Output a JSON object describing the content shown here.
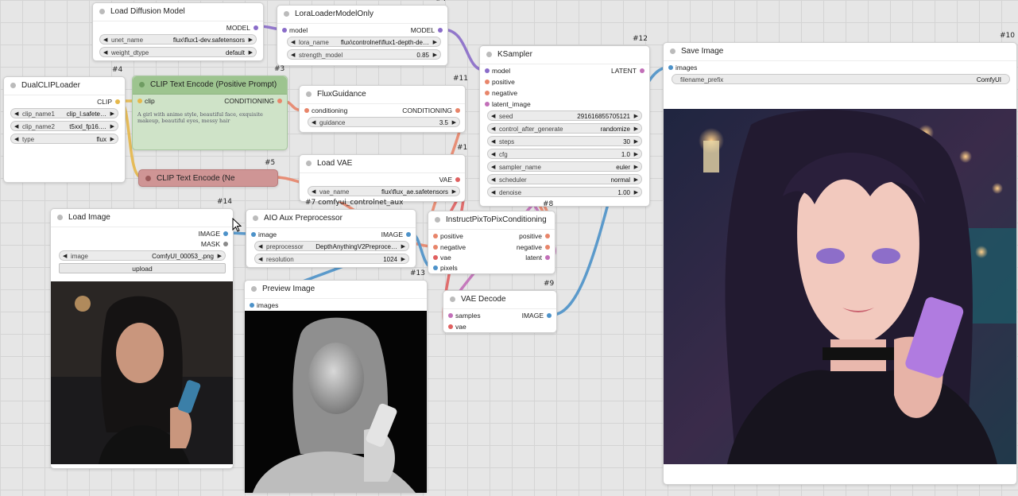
{
  "colors": {
    "model": "#8a6cc9",
    "clip": "#e6b84a",
    "conditioning": "#e8856a",
    "vae": "#e06060",
    "latent": "#c26fb8",
    "image": "#4d92c9",
    "mask": "#8a8a8a",
    "float": "#aaaaaa"
  },
  "nodes": {
    "load_diffusion_model": {
      "title": "Load Diffusion Model",
      "out_model": "MODEL",
      "unet_name_label": "unet_name",
      "unet_name_value": "flux\\flux1-dev.safetensors",
      "weight_dtype_label": "weight_dtype",
      "weight_dtype_value": "default"
    },
    "lora_loader": {
      "id": "#4",
      "title": "LoraLoaderModelOnly",
      "in_model": "model",
      "out_model": "MODEL",
      "lora_name_label": "lora_name",
      "lora_name_value": "flux\\controlnet\\flux1-depth-de…",
      "strength_label": "strength_model",
      "strength_value": "0.85"
    },
    "ksampler": {
      "id": "#12",
      "title": "KSampler",
      "in_model": "model",
      "in_positive": "positive",
      "in_negative": "negative",
      "in_latent": "latent_image",
      "out_latent": "LATENT",
      "seed_label": "seed",
      "seed_value": "291616855705121",
      "control_label": "control_after_generate",
      "control_value": "randomize",
      "steps_label": "steps",
      "steps_value": "30",
      "cfg_label": "cfg",
      "cfg_value": "1.0",
      "sampler_label": "sampler_name",
      "sampler_value": "euler",
      "scheduler_label": "scheduler",
      "scheduler_value": "normal",
      "denoise_label": "denoise",
      "denoise_value": "1.00"
    },
    "save_image": {
      "id": "#10",
      "title": "Save Image",
      "in_images": "images",
      "prefix_label": "filename_prefix",
      "prefix_value": "ComfyUI"
    },
    "dual_clip": {
      "id": "#4",
      "title": "DualCLIPLoader",
      "out_clip": "CLIP",
      "clip1_label": "clip_name1",
      "clip1_value": "clip_l.safete…",
      "clip2_label": "clip_name2",
      "clip2_value": "t5xxl_fp16.…",
      "type_label": "type",
      "type_value": "flux"
    },
    "clip_pos": {
      "id": "#3",
      "title": "CLIP Text Encode (Positive Prompt)",
      "in_clip": "clip",
      "out_cond": "CONDITIONING",
      "prompt": "A girl with anime style, beautiful face, exquisite makeup, beautiful eyes, messy hair"
    },
    "flux_guidance": {
      "id": "#11",
      "title": "FluxGuidance",
      "in_cond": "conditioning",
      "out_cond": "CONDITIONING",
      "guidance_label": "guidance",
      "guidance_value": "3.5"
    },
    "clip_neg": {
      "id": "#5",
      "title": "CLIP Text Encode (Ne"
    },
    "load_vae": {
      "id": "#1",
      "title": "Load VAE",
      "out_vae": "VAE",
      "vae_label": "vae_name",
      "vae_value": "flux\\flux_ae.safetensors"
    },
    "load_image": {
      "id": "#14",
      "title": "Load Image",
      "out_image": "IMAGE",
      "out_mask": "MASK",
      "image_label": "image",
      "image_value": "ComfyUI_00053_.png",
      "upload_label": "upload"
    },
    "aio_aux": {
      "extra_label": "#7 comfyui_controlnet_aux",
      "title": "AIO Aux Preprocessor",
      "in_image": "image",
      "out_image": "IMAGE",
      "pre_label": "preprocessor",
      "pre_value": "DepthAnythingV2Preproce…",
      "res_label": "resolution",
      "res_value": "1024"
    },
    "instruct": {
      "id": "#8",
      "title": "InstructPixToPixConditioning",
      "in_positive": "positive",
      "in_negative": "negative",
      "in_vae": "vae",
      "in_pixels": "pixels",
      "out_positive": "positive",
      "out_negative": "negative",
      "out_latent": "latent"
    },
    "preview": {
      "id": "#13",
      "title": "Preview Image",
      "in_images": "images"
    },
    "vae_decode": {
      "id": "#9",
      "title": "VAE Decode",
      "in_samples": "samples",
      "in_vae": "vae",
      "out_image": "IMAGE"
    }
  }
}
